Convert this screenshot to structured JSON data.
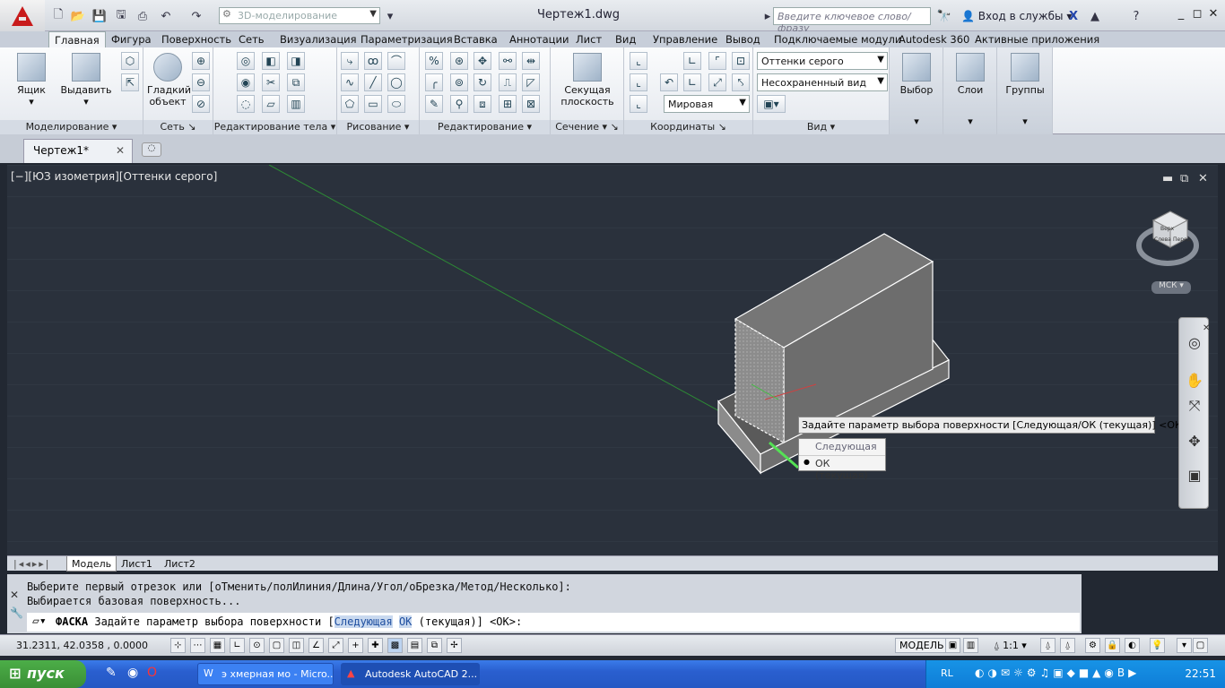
{
  "titlebar": {
    "workspace": "3D-моделирование",
    "doc_title": "Чертеж1.dwg",
    "search_placeholder": "Введите ключевое слово/фразу",
    "signin": "Вход в службы"
  },
  "tabs": [
    "Главная",
    "Фигура",
    "Поверхность",
    "Сеть",
    "Визуализация",
    "Параметризация",
    "Вставка",
    "Аннотации",
    "Лист",
    "Вид",
    "Управление",
    "Вывод",
    "Подключаемые модули",
    "Autodesk 360",
    "Активные приложения"
  ],
  "ribbon": {
    "panels": {
      "modeling": "Моделирование",
      "mesh": "Сеть",
      "solid_edit": "Редактирование тела",
      "draw": "Рисование",
      "edit": "Редактирование",
      "section": "Сечение",
      "coordinates": "Координаты",
      "view": "Вид"
    },
    "box": "Ящик",
    "extrude": "Выдавить",
    "smooth": "Гладкий объект",
    "section_plane": "Секущая плоскость",
    "select": "Выбор",
    "layers": "Слои",
    "groups": "Группы",
    "visual_style": "Оттенки серого",
    "named_view": "Несохраненный вид",
    "ucs": "Мировая"
  },
  "filetab": {
    "label": "Чертеж1*"
  },
  "viewport": {
    "label": "[−][ЮЗ изометрия][Оттенки серого]",
    "tooltip": "Задайте параметр выбора поверхности [Следующая/ОК (текущая)] <ОК>:",
    "menu": [
      "Следующая",
      "ОК (текущая)"
    ],
    "ucs_label": "МСК",
    "viewcube_faces": [
      "Верх",
      "Слева",
      "Перед"
    ]
  },
  "layouttabs": [
    "Модель",
    "Лист1",
    "Лист2"
  ],
  "command": {
    "line1": "Выберите первый отрезок или [оТменить/полИлиния/Длина/Угол/оБрезка/Метод/Несколько]:",
    "line2": "Выбирается базовая поверхность...",
    "cmd_name": "ФАСКА",
    "prompt": "Задайте параметр выбора поверхности [",
    "opt1": "Следующая",
    "opt2": "ОК",
    "tail": " (текущая)] <ОК>:"
  },
  "status": {
    "coords": "31.2311, 42.0358 , 0.0000",
    "model": "МОДЕЛЬ",
    "scale": "1:1"
  },
  "taskbar": {
    "start": "пуск",
    "tasks": [
      "э хмерная мо - Micro...",
      "Autodesk AutoCAD 2..."
    ],
    "lang": "RL",
    "clock": "22:51"
  }
}
